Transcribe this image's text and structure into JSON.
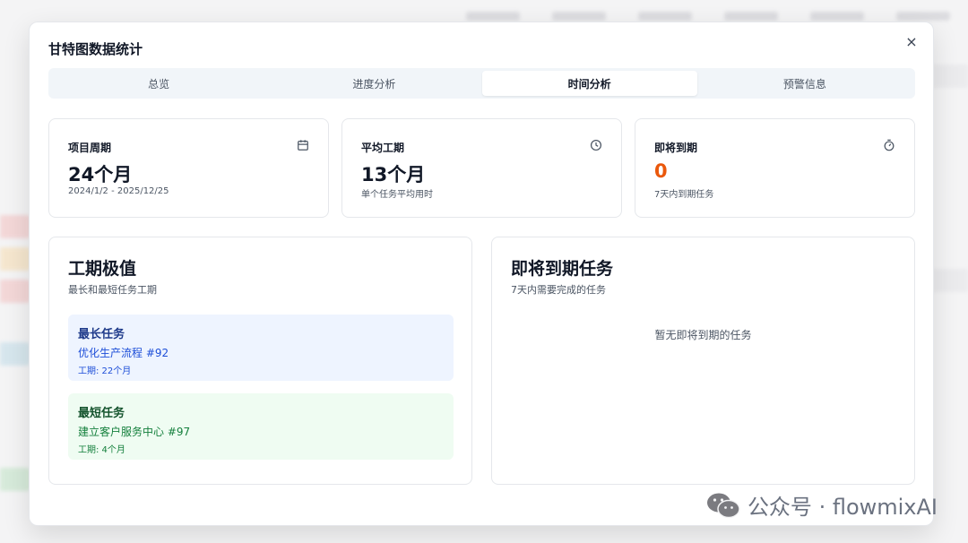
{
  "modal": {
    "title": "甘特图数据统计",
    "close_glyph": "×"
  },
  "tabs": [
    {
      "label": "总览",
      "active": false
    },
    {
      "label": "进度分析",
      "active": false
    },
    {
      "label": "时间分析",
      "active": true
    },
    {
      "label": "预警信息",
      "active": false
    }
  ],
  "stats": [
    {
      "label": "项目周期",
      "value": "24个月",
      "sub": "2024/1/2 - 2025/12/25",
      "icon": "calendar-icon"
    },
    {
      "label": "平均工期",
      "value": "13个月",
      "sub": "单个任务平均用时",
      "icon": "clock-icon"
    },
    {
      "label": "即将到期",
      "value": "0",
      "sub": "7天内到期任务",
      "icon": "timer-icon",
      "value_color": "#ea580c"
    }
  ],
  "duration_panel": {
    "title": "工期极值",
    "subtitle": "最长和最短任务工期",
    "longest": {
      "heading": "最长任务",
      "name": "优化生产流程 #92",
      "duration": "工期: 22个月"
    },
    "shortest": {
      "heading": "最短任务",
      "name": "建立客户服务中心 #97",
      "duration": "工期: 4个月"
    }
  },
  "due_panel": {
    "title": "即将到期任务",
    "subtitle": "7天内需要完成的任务",
    "empty": "暂无即将到期的任务"
  },
  "watermark": {
    "text": "公众号 · flowmixAI",
    "icon": "wechat-icon"
  },
  "colors": {
    "accent_orange": "#ea580c",
    "longest_bg": "#eef4ff",
    "shortest_bg": "#effcf2"
  }
}
